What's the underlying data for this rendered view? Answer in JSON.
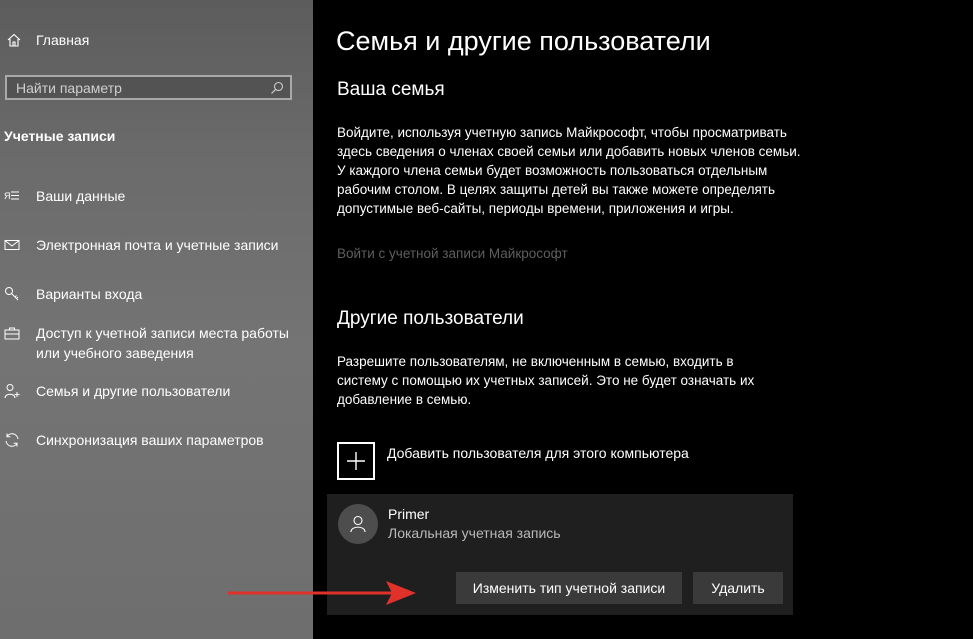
{
  "sidebar": {
    "home_label": "Главная",
    "search_placeholder": "Найти параметр",
    "section_title": "Учетные записи",
    "items": [
      {
        "label": "Ваши данные",
        "icon": "person-card-icon"
      },
      {
        "label": "Электронная почта и учетные записи",
        "icon": "mail-icon"
      },
      {
        "label": "Варианты входа",
        "icon": "key-icon"
      },
      {
        "label": "Доступ к учетной записи места работы или учебного заведения",
        "icon": "briefcase-icon"
      },
      {
        "label": "Семья и другие пользователи",
        "icon": "person-add-icon"
      },
      {
        "label": "Синхронизация ваших параметров",
        "icon": "sync-icon"
      }
    ]
  },
  "main": {
    "title": "Семья и другие пользователи",
    "family": {
      "heading": "Ваша семья",
      "description": "Войдите, используя учетную запись Майкрософт, чтобы просматривать здесь сведения о членах своей семьи или добавить новых членов семьи. У каждого члена семьи будет возможность пользоваться отдельным рабочим столом. В целях защиты детей вы также можете определять допустимые веб-сайты, периоды времени, приложения и игры.",
      "signin_link": "Войти с учетной записи Майкрософт"
    },
    "others": {
      "heading": "Другие пользователи",
      "description": "Разрешите пользователям, не включенным в семью, входить в систему с помощью их учетных записей. Это не будет означать их добавление в семью.",
      "add_label": "Добавить пользователя для этого компьютера",
      "user": {
        "name": "Primer",
        "type": "Локальная учетная запись",
        "change_button": "Изменить тип учетной записи",
        "delete_button": "Удалить"
      }
    }
  },
  "colors": {
    "annotation_arrow": "#e0322b",
    "button_bg": "#3a3a3a",
    "card_bg": "#1f1f1f"
  }
}
